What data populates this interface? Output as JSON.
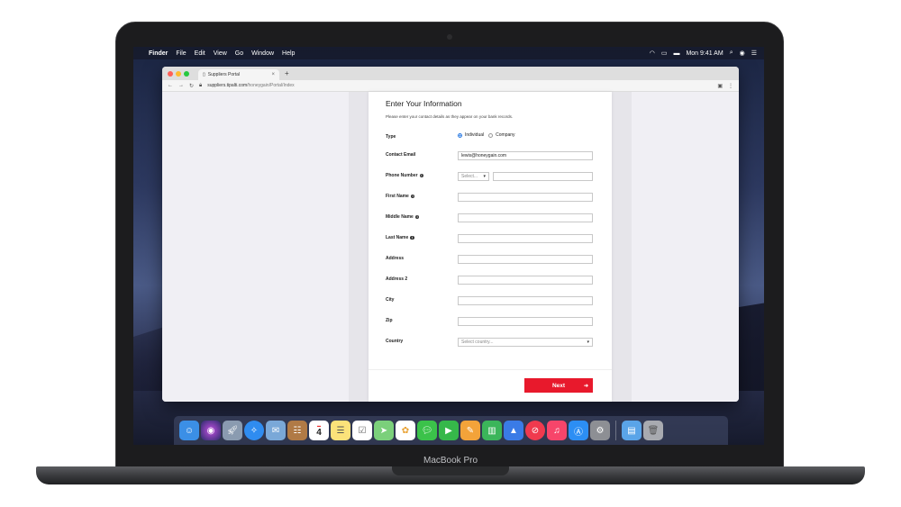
{
  "device": {
    "label": "MacBook Pro"
  },
  "menubar": {
    "apple": "",
    "app_name": "Finder",
    "menus": [
      "File",
      "Edit",
      "View",
      "Go",
      "Window",
      "Help"
    ],
    "clock": "Mon 9:41 AM"
  },
  "browser": {
    "tab_title": "Suppliers Portal",
    "tab_close": "×",
    "new_tab": "+",
    "url_host": "suppliers.tipalti.com",
    "url_path": "/honeygain/Portal/Index"
  },
  "form": {
    "title": "Enter Your Information",
    "subtitle": "Please enter your contact details as they appear on your bank records.",
    "type_label": "Type",
    "type_options": [
      "Individual",
      "Company"
    ],
    "type_selected": "Individual",
    "email_label": "Contact Email",
    "email_value": "lewis@honeygain.com",
    "phone_label": "Phone Number",
    "phone_code_placeholder": "Select...",
    "first_name_label": "First Name",
    "middle_name_label": "Middle Name",
    "last_name_label": "Last Name",
    "address_label": "Address",
    "address2_label": "Address 2",
    "city_label": "City",
    "zip_label": "Zip",
    "country_label": "Country",
    "country_placeholder": "Select country...",
    "next_label": "Next",
    "info_glyph": "i"
  },
  "dock": {
    "apps": [
      "finder",
      "siri",
      "launchpad",
      "safari",
      "mail",
      "contacts",
      "calendar",
      "notes",
      "reminders",
      "maps",
      "photos",
      "messages",
      "facetime",
      "pages",
      "numbers",
      "keynote",
      "news",
      "music",
      "app-store",
      "system-preferences"
    ],
    "calendar_day": "4",
    "trailing": [
      "downloads-folder",
      "trash"
    ]
  }
}
